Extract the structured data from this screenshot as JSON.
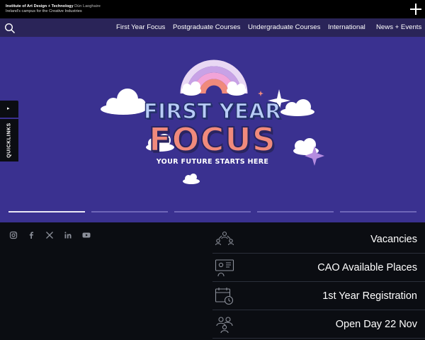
{
  "brand": {
    "line1_bold": "Institute of Art Design + Technology",
    "line1_light": "Dún Laoghaire",
    "line2": "Ireland's campus for the Creative Industries"
  },
  "nav": {
    "items": [
      {
        "label": "First Year Focus"
      },
      {
        "label": "Postgraduate Courses"
      },
      {
        "label": "Undergraduate Courses"
      },
      {
        "label": "International"
      },
      {
        "label": "News + Events"
      }
    ]
  },
  "hero": {
    "title_line1": "FIRST YEAR",
    "title_line2": "FOCUS",
    "tagline": "YOUR FUTURE STARTS HERE",
    "slide_count": 5,
    "active_slide": 1
  },
  "quicklinks": {
    "play_glyph": "▸",
    "label": "QUICKLINKS"
  },
  "social": [
    {
      "icon": "instagram-icon"
    },
    {
      "icon": "facebook-icon"
    },
    {
      "icon": "x-icon"
    },
    {
      "icon": "linkedin-icon"
    },
    {
      "icon": "youtube-icon"
    }
  ],
  "links": [
    {
      "label": "Vacancies",
      "icon": "people-network-icon"
    },
    {
      "label": "CAO Available Places",
      "icon": "presentation-icon"
    },
    {
      "label": "1st Year Registration",
      "icon": "calendar-clock-icon"
    },
    {
      "label": "Open Day 22 Nov",
      "icon": "group-icon"
    }
  ],
  "colors": {
    "hero_bg": "#3a3190",
    "nav_bg": "#2a2458",
    "page_bg": "#0b0d12",
    "title_blue": "#b9cdf7",
    "title_coral": "#f08a7c"
  }
}
